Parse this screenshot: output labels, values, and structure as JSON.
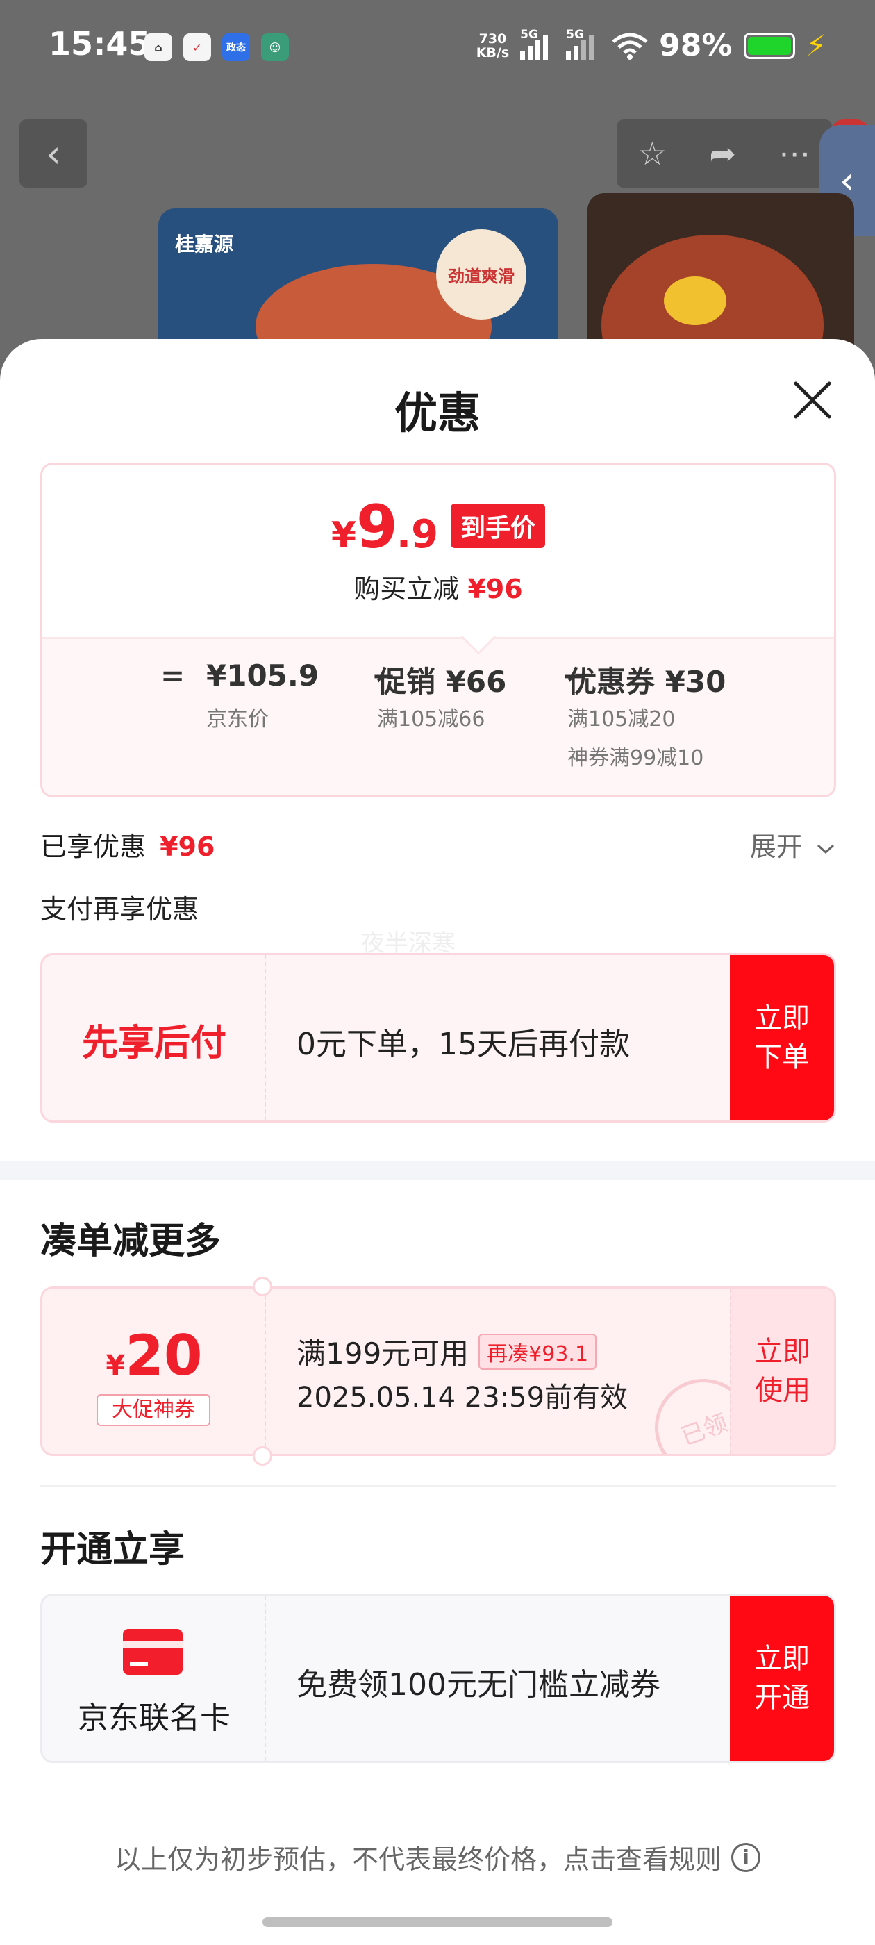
{
  "status_bar": {
    "time": "15:45",
    "net_speed_value": "730",
    "net_speed_unit": "KB/s",
    "sim1": "5G",
    "sim2": "5G",
    "battery": "98%",
    "app_icons": [
      "home-app-icon",
      "xiaohongshu-icon",
      "alipay-icon",
      "avatar-app-icon"
    ],
    "app_icon_3_text": "政态"
  },
  "background": {
    "product_brand": "桂嘉源",
    "product_badge": "劲道爽滑"
  },
  "sheet": {
    "title": "优惠",
    "price_card": {
      "currency": "¥",
      "price_int": "9",
      "price_dec": ".9",
      "price_tag": "到手价",
      "saving_prefix": "购买立减",
      "saving_amount": "¥96",
      "calc": {
        "equals": "=",
        "base_value": "¥105.9",
        "base_label": "京东价",
        "minus": "−",
        "promo_value": "促销 ¥66",
        "promo_label": "满105减66",
        "coupon_value": "优惠券 ¥30",
        "coupon_label_1": "满105减20",
        "coupon_label_2": "神券满99减10"
      }
    },
    "enjoyed": {
      "label": "已享优惠",
      "amount": "¥96",
      "expand": "展开"
    },
    "pay_more_label": "支付再享优惠",
    "watermark": "夜半深寒",
    "pay_later": {
      "title": "先享后付",
      "desc": "0元下单，15天后再付款",
      "cta": "立即\n下单"
    },
    "bundle": {
      "section_title": "凑单减更多",
      "coupon_currency": "¥",
      "coupon_amount": "20",
      "coupon_type": "大促神券",
      "condition": "满199元可用",
      "extra_tag": "再凑¥93.1",
      "valid_until": "2025.05.14 23:59前有效",
      "stamp": "已领",
      "cta": "立即\n使用"
    },
    "open": {
      "section_title": "开通立享",
      "card_name": "京东联名卡",
      "desc": "免费领100元无门槛立减券",
      "cta": "立即\n开通"
    },
    "footer_note": "以上仅为初步预估，不代表最终价格，点击查看规则",
    "info_icon_glyph": "i"
  },
  "colors": {
    "accent_red": "#EF1F2C",
    "cta_red": "#FF0A14",
    "pink_bg": "#FFF4F5",
    "overlay_gray": "#6B6B6B"
  }
}
